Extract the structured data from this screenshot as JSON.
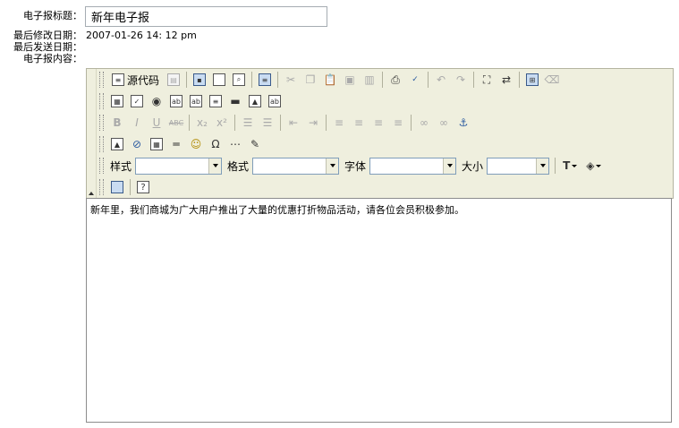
{
  "form": {
    "title_label": "电子报标题：",
    "title_value": "新年电子报",
    "modified_label": "最后修改日期：",
    "modified_value": "2007-01-26 14: 12 pm",
    "sent_label": "最后发送日期：",
    "content_label": "电子报内容："
  },
  "toolbar": {
    "source_label": "源代码",
    "style_label": "样式",
    "format_label": "格式",
    "font_label": "字体",
    "size_label": "大小",
    "style_value": "",
    "format_value": "",
    "font_value": "",
    "size_value": ""
  },
  "editor": {
    "content": "新年里，我们商城为广大用户推出了大量的优惠打折物品活动，请各位会员积极参加。"
  }
}
